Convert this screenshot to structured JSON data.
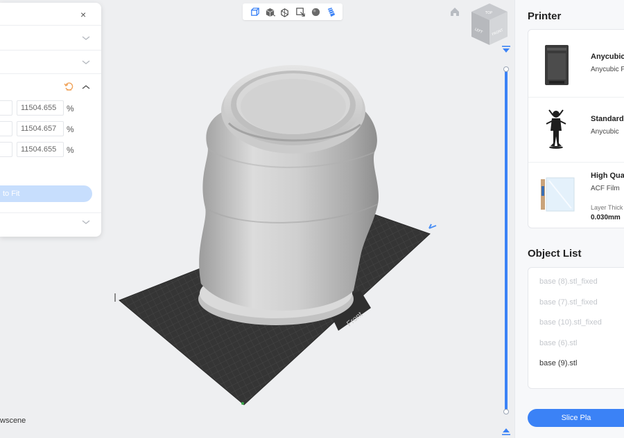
{
  "left_panel": {
    "close_label": "×",
    "scale_values": [
      "11504.655",
      "11504.657",
      "11504.655"
    ],
    "unit": "%",
    "fit_button_label": "to Fit",
    "scene_label": "wscene"
  },
  "viewport": {
    "plate_label": "Front",
    "view_cube": {
      "top_label": "TOP",
      "left_label": "LEFT",
      "front_label": "FRONT"
    },
    "toolbar_icons": [
      "perspective-icon",
      "shading-icon",
      "multi-view-icon",
      "frame-select-icon",
      "sphere-icon",
      "layers-icon"
    ],
    "accent_color": "#3b82f6"
  },
  "sidebar": {
    "printer_title": "Printer",
    "printer": {
      "name": "Anycubic",
      "model": "Anycubic P"
    },
    "resin": {
      "name": "Standard",
      "brand": "Anycubic"
    },
    "profile": {
      "name": "High Qual",
      "film": "ACF Film",
      "layer_label": "Layer Thick",
      "layer_value": "0.030mm"
    },
    "object_list_title": "Object List",
    "objects": [
      {
        "label": "base (8).stl_fixed",
        "state": "dim"
      },
      {
        "label": "base (7).stl_fixed",
        "state": "dim"
      },
      {
        "label": "base (10).stl_fixed",
        "state": "dim"
      },
      {
        "label": "base (6).stl",
        "state": "dim"
      },
      {
        "label": "base (9).stl",
        "state": "active"
      }
    ],
    "slice_button_label": "Slice Pla"
  }
}
